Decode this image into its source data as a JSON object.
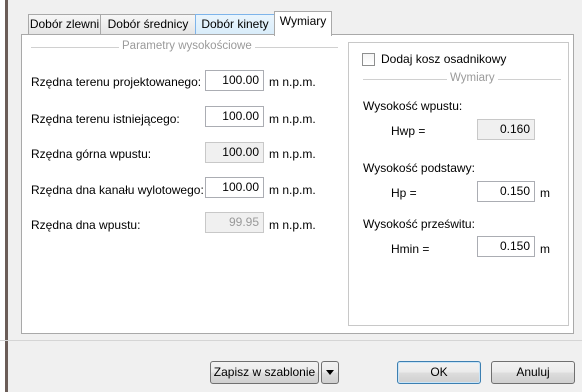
{
  "tabs": [
    {
      "label": "Dobór zlewni"
    },
    {
      "label": "Dobór średnicy"
    },
    {
      "label": "Dobór kinety"
    },
    {
      "label": "Wymiary"
    }
  ],
  "left": {
    "group_title": "Parametry wysokościowe",
    "rows": [
      {
        "label": "Rzędna terenu projektowanego:",
        "value": "100.00",
        "unit": "m n.p.m.",
        "state": "editable"
      },
      {
        "label": "Rzędna terenu istniejącego:",
        "value": "100.00",
        "unit": "m n.p.m.",
        "state": "editable"
      },
      {
        "label": "Rzędna górna wpustu:",
        "value": "100.00",
        "unit": "m n.p.m.",
        "state": "readonly"
      },
      {
        "label": "Rzędna dna kanału wylotowego:",
        "value": "100.00",
        "unit": "m n.p.m.",
        "state": "editable"
      },
      {
        "label": "Rzędna dna wpustu:",
        "value": "99.95",
        "unit": "m n.p.m.",
        "state": "disabled"
      }
    ]
  },
  "right": {
    "checkbox_label": "Dodaj kosz osadnikowy",
    "checkbox_checked": false,
    "group_title": "Wymiary",
    "inlet_height": {
      "label": "Wysokość wpustu:",
      "symbol": "Hwp =",
      "value": "0.160"
    },
    "base_height": {
      "label": "Wysokość podstawy:",
      "symbol": "Hp =",
      "value": "0.150",
      "unit": "m"
    },
    "clearance_height": {
      "label": "Wysokość prześwitu:",
      "symbol": "Hmin =",
      "value": "0.150",
      "unit": "m"
    }
  },
  "footer": {
    "save_template_label": "Zapisz w szablonie",
    "ok_label": "OK",
    "cancel_label": "Anuluj"
  }
}
